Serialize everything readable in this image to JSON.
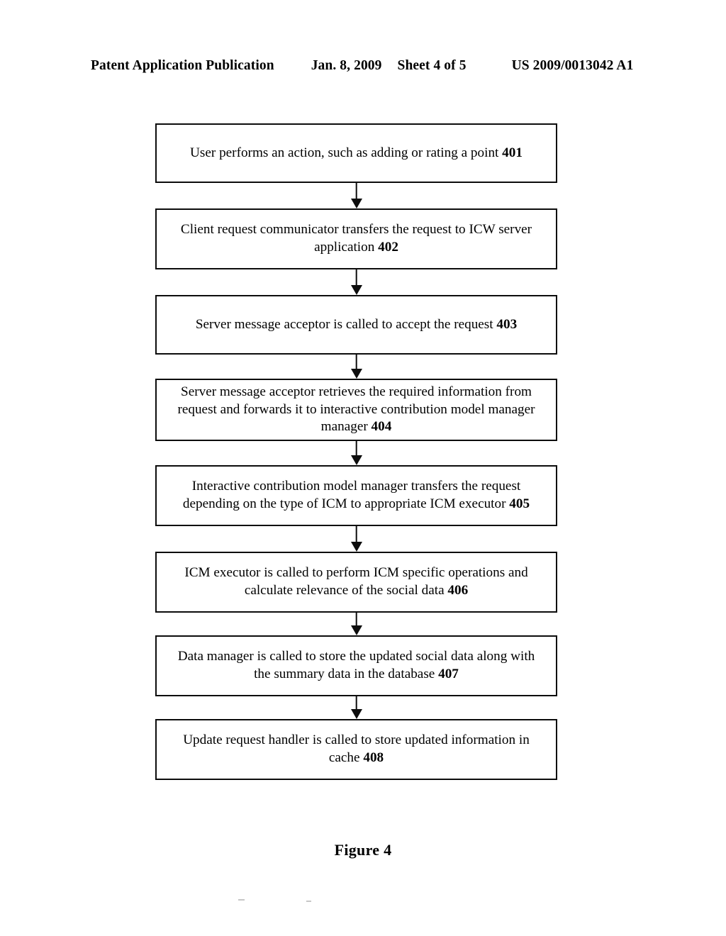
{
  "header": {
    "publication": "Patent Application Publication",
    "date": "Jan. 8, 2009",
    "sheet": "Sheet 4 of 5",
    "number": "US 2009/0013042 A1"
  },
  "figure": {
    "caption": "Figure 4"
  },
  "flowchart": {
    "steps": [
      {
        "id": "401",
        "text": "User performs an action, such as adding or rating a point ",
        "ref": "401"
      },
      {
        "id": "402",
        "text": "Client request communicator transfers the request to ICW server application ",
        "ref": "402"
      },
      {
        "id": "403",
        "text": "Server message acceptor is called to accept the request ",
        "ref": "403"
      },
      {
        "id": "404",
        "text": "Server message acceptor retrieves the required information from request and forwards it to interactive contribution model manager manager ",
        "ref": "404"
      },
      {
        "id": "405",
        "text": "Interactive contribution model manager transfers the request depending on the type of ICM to appropriate ICM executor ",
        "ref": "405"
      },
      {
        "id": "406",
        "text": "ICM executor is called to perform ICM specific operations and calculate relevance of the social data ",
        "ref": "406"
      },
      {
        "id": "407",
        "text": "Data manager is called to store the updated social data along with the summary data in the database ",
        "ref": "407"
      },
      {
        "id": "408",
        "text": "Update request handler is called to store updated information in cache ",
        "ref": "408"
      }
    ]
  },
  "colors": {
    "ink": "#0d0d0d",
    "paper": "#ffffff"
  }
}
